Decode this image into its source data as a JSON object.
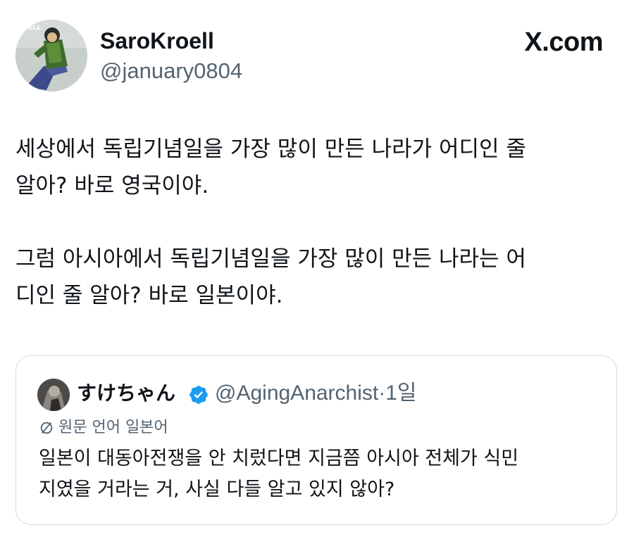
{
  "author": {
    "display_name": "SaroKroell",
    "handle": "@january0804",
    "avatar_icon": "profile-avatar"
  },
  "brand": {
    "label": "X.com"
  },
  "tweet": {
    "paragraphs": [
      "세상에서 독립기념일을 가장 많이 만든 나라가 어디인 줄\n알아? 바로 영국이야.",
      "그럼 아시아에서 독립기념일을 가장 많이 만든 나라는 어\n디인 줄 알아? 바로 일본이야."
    ]
  },
  "quoted": {
    "display_name": "すけちゃん",
    "verified_icon": "verified-badge-icon",
    "handle": "@AgingAnarchist",
    "separator": "·",
    "time": "1일",
    "translate_label": "원문 언어 일본어",
    "text": "일본이 대동아전쟁을 안 치렀다면 지금쯤 아시아 전체가 식민\n지였을 거라는 거, 사실 다들 알고 있지 않아?"
  },
  "colors": {
    "text_primary": "#0f1419",
    "text_secondary": "#536471",
    "border": "#cfd9de",
    "verified": "#1d9bf0"
  }
}
